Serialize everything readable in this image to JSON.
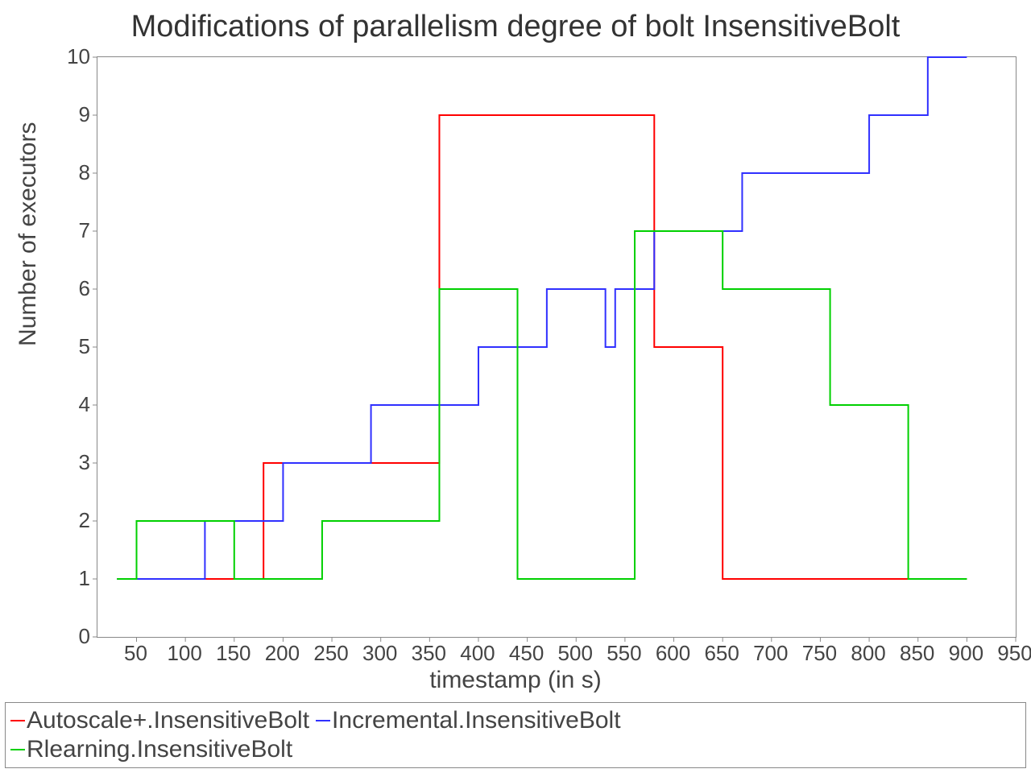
{
  "chart_data": {
    "type": "line",
    "title": "Modifications of parallelism degree of bolt InsensitiveBolt",
    "xlabel": "timestamp (in s)",
    "ylabel": "Number of executors",
    "xlim": [
      10,
      950
    ],
    "ylim": [
      0,
      10
    ],
    "xticks": [
      50,
      100,
      150,
      200,
      250,
      300,
      350,
      400,
      450,
      500,
      550,
      600,
      650,
      700,
      750,
      800,
      850,
      900,
      950
    ],
    "yticks": [
      0,
      1,
      2,
      3,
      4,
      5,
      6,
      7,
      8,
      9,
      10
    ],
    "series": [
      {
        "name": "Autoscale+.InsensitiveBolt",
        "color": "#ff0000",
        "points": [
          [
            30,
            1
          ],
          [
            170,
            1
          ],
          [
            180,
            3
          ],
          [
            350,
            3
          ],
          [
            360,
            9
          ],
          [
            560,
            9
          ],
          [
            580,
            5
          ],
          [
            640,
            5
          ],
          [
            650,
            1
          ],
          [
            900,
            1
          ]
        ]
      },
      {
        "name": "Incremental.InsensitiveBolt",
        "color": "#3030ff",
        "points": [
          [
            30,
            1
          ],
          [
            70,
            1
          ],
          [
            120,
            2
          ],
          [
            170,
            2
          ],
          [
            200,
            3
          ],
          [
            280,
            3
          ],
          [
            290,
            4
          ],
          [
            360,
            4
          ],
          [
            400,
            5
          ],
          [
            460,
            5
          ],
          [
            470,
            6
          ],
          [
            520,
            6
          ],
          [
            530,
            5
          ],
          [
            540,
            6
          ],
          [
            560,
            6
          ],
          [
            580,
            7
          ],
          [
            660,
            7
          ],
          [
            670,
            8
          ],
          [
            780,
            8
          ],
          [
            800,
            9
          ],
          [
            840,
            9
          ],
          [
            860,
            10
          ],
          [
            900,
            10
          ]
        ]
      },
      {
        "name": "Rlearning.InsensitiveBolt",
        "color": "#00d000",
        "points": [
          [
            30,
            1
          ],
          [
            50,
            2
          ],
          [
            120,
            2
          ],
          [
            150,
            1
          ],
          [
            220,
            1
          ],
          [
            240,
            2
          ],
          [
            350,
            2
          ],
          [
            360,
            6
          ],
          [
            420,
            6
          ],
          [
            440,
            1
          ],
          [
            540,
            1
          ],
          [
            560,
            7
          ],
          [
            640,
            7
          ],
          [
            650,
            6
          ],
          [
            740,
            6
          ],
          [
            760,
            4
          ],
          [
            790,
            4
          ],
          [
            840,
            1
          ],
          [
            900,
            1
          ]
        ]
      }
    ],
    "legend_layout": [
      [
        "Autoscale+.InsensitiveBolt",
        "Incremental.InsensitiveBolt"
      ],
      [
        "Rlearning.InsensitiveBolt"
      ]
    ]
  }
}
